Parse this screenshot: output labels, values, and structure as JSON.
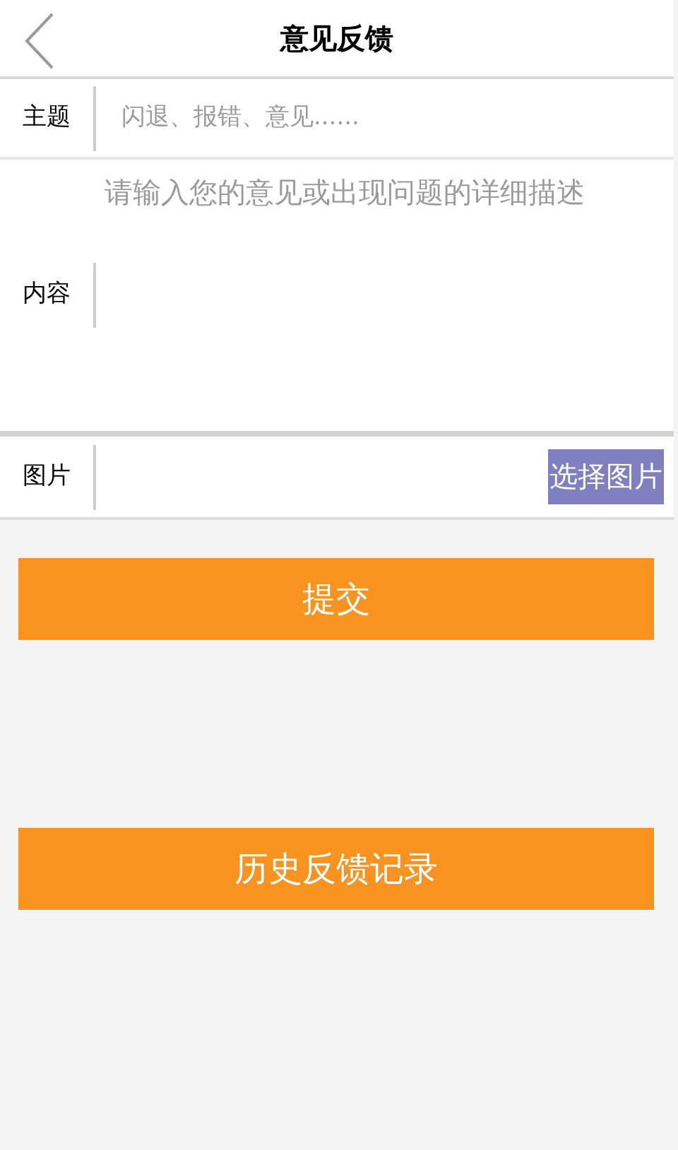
{
  "header": {
    "title": "意见反馈"
  },
  "form": {
    "subject": {
      "label": "主题",
      "placeholder": "闪退、报错、意见......"
    },
    "content": {
      "label": "内容",
      "placeholder": "请输入您的意见或出现问题的详细描述"
    },
    "image": {
      "label": "图片",
      "button": "选择图片"
    }
  },
  "buttons": [
    "提交",
    "历史反馈记录"
  ]
}
